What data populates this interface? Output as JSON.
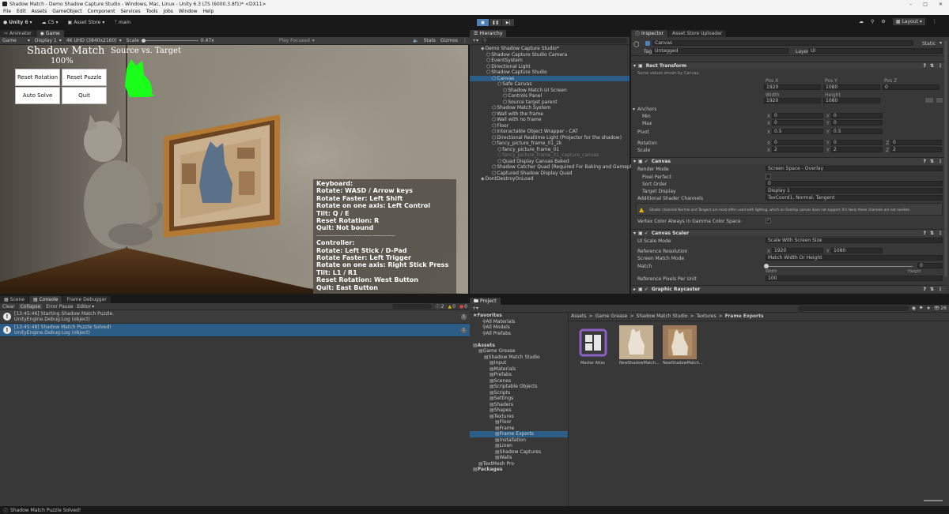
{
  "window": {
    "title": "Shadow Match - Demo Shadow Capture Studio - Windows, Mac, Linux - Unity 6.3 LTS (6000.3.8f1)* <DX11>"
  },
  "menu": [
    "File",
    "Edit",
    "Assets",
    "GameObject",
    "Component",
    "Services",
    "Tools",
    "Jobs",
    "Window",
    "Help"
  ],
  "toolbar": {
    "account": "Unity 6",
    "cs": "CS",
    "asset_store": "Asset Store",
    "branch": "main",
    "layout": "Layout"
  },
  "left_tabs": [
    "Animator",
    "Game"
  ],
  "game_bar": {
    "mode": "Game",
    "display": "Display 1",
    "resolution": "4K UHD (3840x2160)",
    "scale_label": "Scale",
    "scale_value": "0.47x",
    "play_focused": "Play Focused",
    "stats": "Stats",
    "gizmos": "Gizmos"
  },
  "game": {
    "title": "Shadow Match",
    "percent": "100%",
    "source_vs_target": "Source vs. Target",
    "buttons": {
      "reset_rotation": "Reset Rotation",
      "reset_puzzle": "Reset Puzzle",
      "auto_solve": "Auto Solve",
      "quit": "Quit"
    },
    "help_lines": [
      "Keyboard:",
      "Rotate: WASD / Arrow keys",
      "Rotate Faster: Left Shift",
      "Rotate on one axis: Left Control",
      "Tilt: Q / E",
      "Reset Rotation: R",
      "Quit: Not bound",
      "----------------------------------------------",
      "Controller:",
      "Rotate: Left Stick / D-Pad",
      "Rotate Faster: Left Trigger",
      "Rotate on one axis: Right Stick Press",
      "Tilt: L1 / R1",
      "Reset Rotation: West Button",
      "Quit: East Button"
    ]
  },
  "hierarchy": {
    "tab": "Hierarchy",
    "items": [
      {
        "label": "Demo Shadow Capture Studio*",
        "depth": 0
      },
      {
        "label": "Shadow Capture Studio Camera",
        "depth": 1
      },
      {
        "label": "EventSystem",
        "depth": 1
      },
      {
        "label": "Directional Light",
        "depth": 1
      },
      {
        "label": "Shadow Capture Studio",
        "depth": 1
      },
      {
        "label": "Canvas",
        "depth": 2
      },
      {
        "label": "Safe Canvas",
        "depth": 3
      },
      {
        "label": "Shadow Match UI Screen",
        "depth": 4
      },
      {
        "label": "Controls Panel",
        "depth": 4
      },
      {
        "label": "Source target parent",
        "depth": 4
      },
      {
        "label": "Shadow Match System",
        "depth": 2
      },
      {
        "label": "Wall with the frame",
        "depth": 2
      },
      {
        "label": "Wall with no frame",
        "depth": 2
      },
      {
        "label": "Floor",
        "depth": 2
      },
      {
        "label": "Interactable Object Wrapper - CAT",
        "depth": 2
      },
      {
        "label": "Directional Realtime Light (Projector for the shadow)",
        "depth": 2
      },
      {
        "label": "fancy_picture_frame_01_2k",
        "depth": 2
      },
      {
        "label": "fancy_picture_frame_01",
        "depth": 3
      },
      {
        "label": "fancy_picture_frame_01_capture_canvas",
        "depth": 3
      },
      {
        "label": "Quad Display Canvas Baked",
        "depth": 3
      },
      {
        "label": "Shadow Catcher Quad (Required For Baking and Gameplay)",
        "depth": 2
      },
      {
        "label": "Captured Shadow Display Quad",
        "depth": 2
      },
      {
        "label": "DontDestroyOnLoad",
        "depth": 0
      }
    ]
  },
  "inspector": {
    "tabs": [
      "Inspector",
      "Asset Store Uploader"
    ],
    "object_name": "Canvas",
    "static_label": "Static",
    "tag_label": "Tag",
    "tag_value": "Untagged",
    "layer_label": "Layer",
    "layer_value": "UI",
    "rect_transform": {
      "title": "Rect Transform",
      "note": "Some values driven by Canvas.",
      "col_labels": [
        "Pos X",
        "Pos Y",
        "Pos Z"
      ],
      "pos": [
        "1920",
        "1080",
        "0"
      ],
      "size_labels": [
        "Width",
        "Height"
      ],
      "size": [
        "1920",
        "1080"
      ],
      "anchors": "Anchors",
      "min": "Min",
      "max": "Max",
      "min_vals": [
        "0",
        "0"
      ],
      "max_vals": [
        "0",
        "0"
      ],
      "pivot": "Pivot",
      "pivot_vals": [
        "0.5",
        "0.5"
      ],
      "rotation": "Rotation",
      "rot_vals": [
        "0",
        "0",
        "0"
      ],
      "scale": "Scale",
      "scale_vals": [
        "2",
        "2",
        "2"
      ]
    },
    "canvas": {
      "title": "Canvas",
      "render_mode_label": "Render Mode",
      "render_mode": "Screen Space - Overlay",
      "pixel_perfect": "Pixel Perfect",
      "sort_order_label": "Sort Order",
      "sort_order": "0",
      "target_display_label": "Target Display",
      "target_display": "Display 1",
      "shader_channels_label": "Additional Shader Channels",
      "shader_channels": "TexCoord1, Normal, Tangent",
      "warning": "Shader channels Normal and Tangent are most often used with lighting, which an Overlay canvas does not support. It's likely these channels are not needed.",
      "vertex_color": "Vertex Color Always In Gamma Color Space"
    },
    "canvas_scaler": {
      "title": "Canvas Scaler",
      "ui_scale_mode_label": "UI Scale Mode",
      "ui_scale_mode": "Scale With Screen Size",
      "ref_res_label": "Reference Resolution",
      "ref_x": "1920",
      "ref_y": "1080",
      "match_mode_label": "Screen Match Mode",
      "match_mode": "Match Width Or Height",
      "match_label": "Match",
      "match_value": "0",
      "match_fraction": 0,
      "width": "Width",
      "height": "Height",
      "ref_ppu_label": "Reference Pixels Per Unit",
      "ref_ppu": "100"
    },
    "graphic_raycaster": "Graphic Raycaster"
  },
  "console": {
    "tabs": [
      "Scene",
      "Console",
      "Frame Debugger"
    ],
    "buttons": [
      "Clear",
      "Collapse",
      "Error Pause",
      "Editor"
    ],
    "counts": [
      "2",
      "0",
      "0"
    ],
    "entries": [
      {
        "time": "[13:45:46] Starting Shadow Match Puzzle.",
        "detail": "UnityEngine.Debug:Log (object)",
        "count": "1",
        "selected": false
      },
      {
        "time": "[13:45:48] Shadow Match Puzzle Solved!",
        "detail": "UnityEngine.Debug:Log (object)",
        "count": "1",
        "selected": true
      }
    ]
  },
  "project": {
    "tab": "Project",
    "favorites": "Favorites",
    "fav_items": [
      "All Materials",
      "All Models",
      "All Prefabs"
    ],
    "tree": [
      {
        "label": "Assets",
        "depth": 0,
        "bold": true
      },
      {
        "label": "Game Grease",
        "depth": 1
      },
      {
        "label": "Shadow Match Studio",
        "depth": 2
      },
      {
        "label": "Input",
        "depth": 3
      },
      {
        "label": "Materials",
        "depth": 3
      },
      {
        "label": "Prefabs",
        "depth": 3
      },
      {
        "label": "Scenes",
        "depth": 3
      },
      {
        "label": "Scriptable Objects",
        "depth": 3
      },
      {
        "label": "Scripts",
        "depth": 3
      },
      {
        "label": "Settings",
        "depth": 3
      },
      {
        "label": "Shaders",
        "depth": 3
      },
      {
        "label": "Shapes",
        "depth": 3
      },
      {
        "label": "Textures",
        "depth": 3
      },
      {
        "label": "Floor",
        "depth": 4
      },
      {
        "label": "Frame",
        "depth": 4
      },
      {
        "label": "Frame Exports",
        "depth": 4,
        "selected": true
      },
      {
        "label": "Installation",
        "depth": 4
      },
      {
        "label": "Linen",
        "depth": 4
      },
      {
        "label": "Shadow Captures",
        "depth": 4
      },
      {
        "label": "Walls",
        "depth": 4
      },
      {
        "label": "TextMesh Pro",
        "depth": 1
      },
      {
        "label": "Packages",
        "depth": 0,
        "bold": true
      }
    ],
    "breadcrumb": [
      "Assets",
      "Game Grease",
      "Shadow Match Studio",
      "Textures",
      "Frame Exports"
    ],
    "assets": [
      "Master Atlas",
      "NewShadowMatch...",
      "NewShadowMatch..."
    ],
    "count": "26"
  },
  "status": {
    "message": "Shadow Match Puzzle Solved!"
  }
}
